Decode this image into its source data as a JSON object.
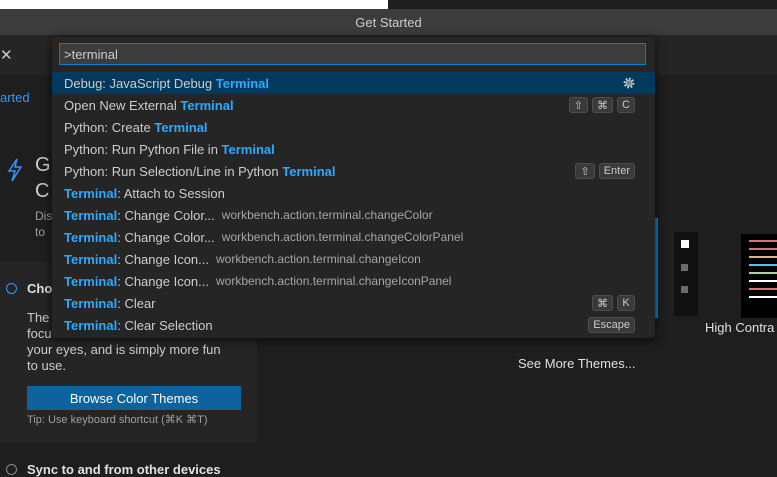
{
  "window": {
    "title": "Get Started"
  },
  "background": {
    "tab_fragment": "arted",
    "heading_fragment_1": "G",
    "heading_fragment_2": "C",
    "sub_fragment_1": "Dis",
    "sub_fragment_2": "to",
    "choose_fragment": "Cho",
    "desc_fragment_1": "The",
    "desc_fragment_2": "focu",
    "desc_line_3": "your eyes, and is simply more fun",
    "desc_line_4": "to use.",
    "browse_button": "Browse Color Themes",
    "tip": "Tip: Use keyboard shortcut (⌘K ⌘T)",
    "sync": "Sync to and from other devices",
    "see_more": "See More Themes...",
    "high_contrast": "High Contra"
  },
  "command_palette": {
    "query": ">terminal",
    "items": [
      {
        "pre": "Debug: JavaScript Debug ",
        "match": "Terminal",
        "post": "",
        "desc": "",
        "selected": true,
        "gear": true,
        "keys": []
      },
      {
        "pre": "Open New External ",
        "match": "Terminal",
        "post": "",
        "desc": "",
        "keys": [
          "⇧",
          "⌘",
          "C"
        ]
      },
      {
        "pre": "Python: Create ",
        "match": "Terminal",
        "post": "",
        "desc": "",
        "keys": []
      },
      {
        "pre": "Python: Run Python File in ",
        "match": "Terminal",
        "post": "",
        "desc": "",
        "keys": []
      },
      {
        "pre": "Python: Run Selection/Line in Python ",
        "match": "Terminal",
        "post": "",
        "desc": "",
        "keys": [
          "⇧",
          "Enter"
        ]
      },
      {
        "pre": "",
        "match": "Terminal",
        "post": ": Attach to Session",
        "desc": "",
        "keys": []
      },
      {
        "pre": "",
        "match": "Terminal",
        "post": ": Change Color...",
        "desc": "workbench.action.terminal.changeColor",
        "keys": []
      },
      {
        "pre": "",
        "match": "Terminal",
        "post": ": Change Color...",
        "desc": "workbench.action.terminal.changeColorPanel",
        "keys": []
      },
      {
        "pre": "",
        "match": "Terminal",
        "post": ": Change Icon...",
        "desc": "workbench.action.terminal.changeIcon",
        "keys": []
      },
      {
        "pre": "",
        "match": "Terminal",
        "post": ": Change Icon...",
        "desc": "workbench.action.terminal.changeIconPanel",
        "keys": []
      },
      {
        "pre": "",
        "match": "Terminal",
        "post": ": Clear",
        "desc": "",
        "keys": [
          "⌘",
          "K"
        ]
      },
      {
        "pre": "",
        "match": "Terminal",
        "post": ": Clear Selection",
        "desc": "",
        "keys": [
          "Escape"
        ]
      }
    ]
  }
}
